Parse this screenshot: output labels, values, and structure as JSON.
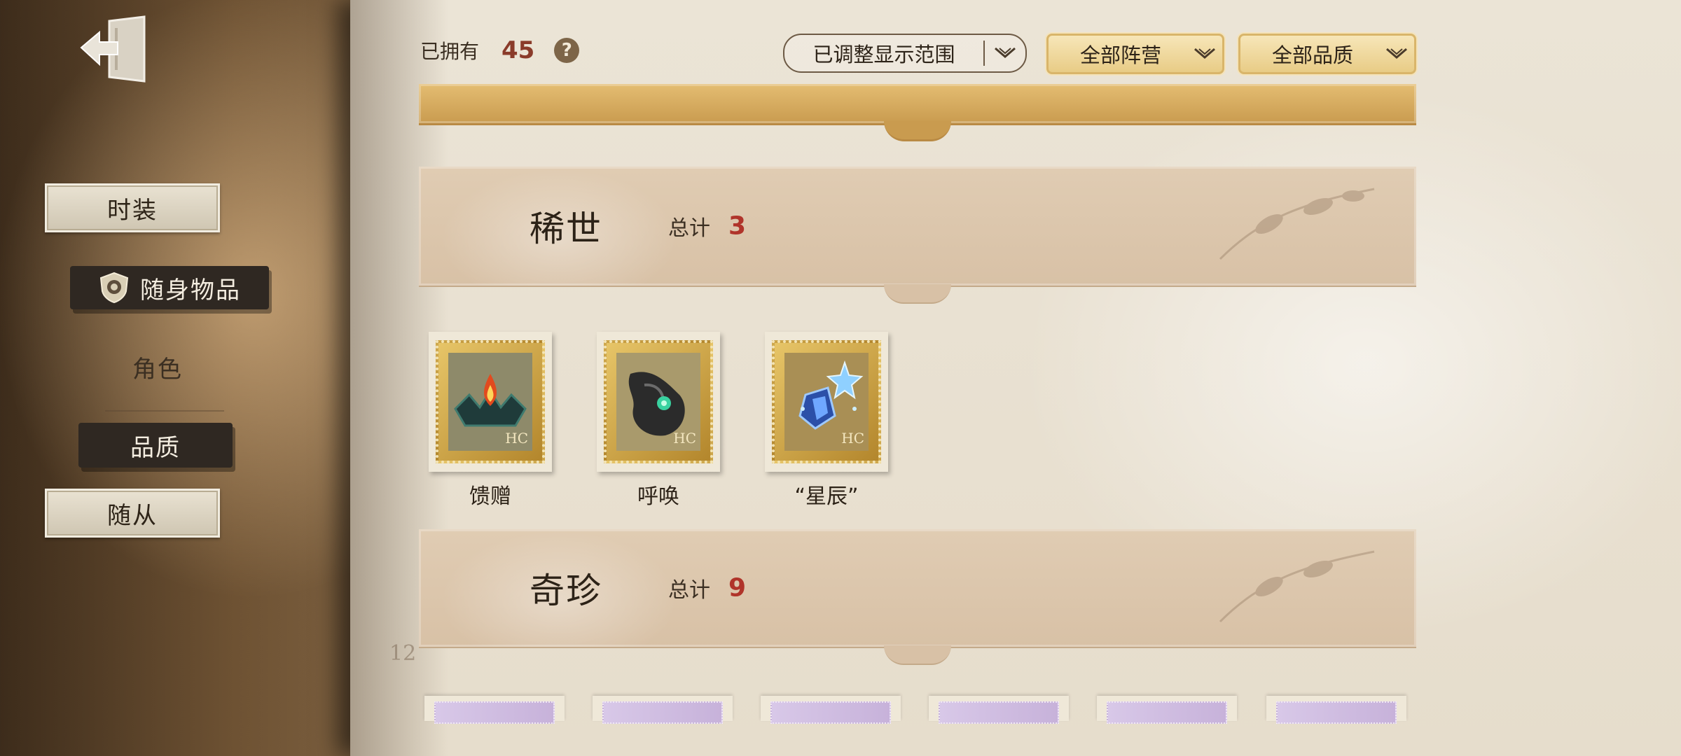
{
  "left_nav": {
    "items": [
      {
        "label": "时装",
        "state": "plaque"
      },
      {
        "label": "随身物品",
        "state": "active",
        "icon": "shield-icon"
      },
      {
        "label": "角色",
        "state": "plain"
      },
      {
        "label": "品质",
        "state": "active"
      },
      {
        "label": "随从",
        "state": "plaque"
      }
    ]
  },
  "topbar": {
    "owned_label": "已拥有",
    "owned_count": "45",
    "help": "?",
    "display_range": "已调整显示范围",
    "faction_filter": "全部阵营",
    "quality_filter": "全部品质"
  },
  "categories": [
    {
      "title": "稀世",
      "total_label": "总计",
      "total": "3"
    },
    {
      "title": "奇珍",
      "total_label": "总计",
      "total": "9"
    }
  ],
  "items": [
    {
      "name": "馈赠",
      "tag": "HC"
    },
    {
      "name": "呼唤",
      "tag": "HC"
    },
    {
      "name": "“星辰”",
      "tag": "HC"
    }
  ],
  "page_number": "12",
  "colors": {
    "accent_red": "#b0342a",
    "gold": "#e8cc86",
    "paper": "#e9e1d1",
    "nav_active": "#2f2822"
  }
}
